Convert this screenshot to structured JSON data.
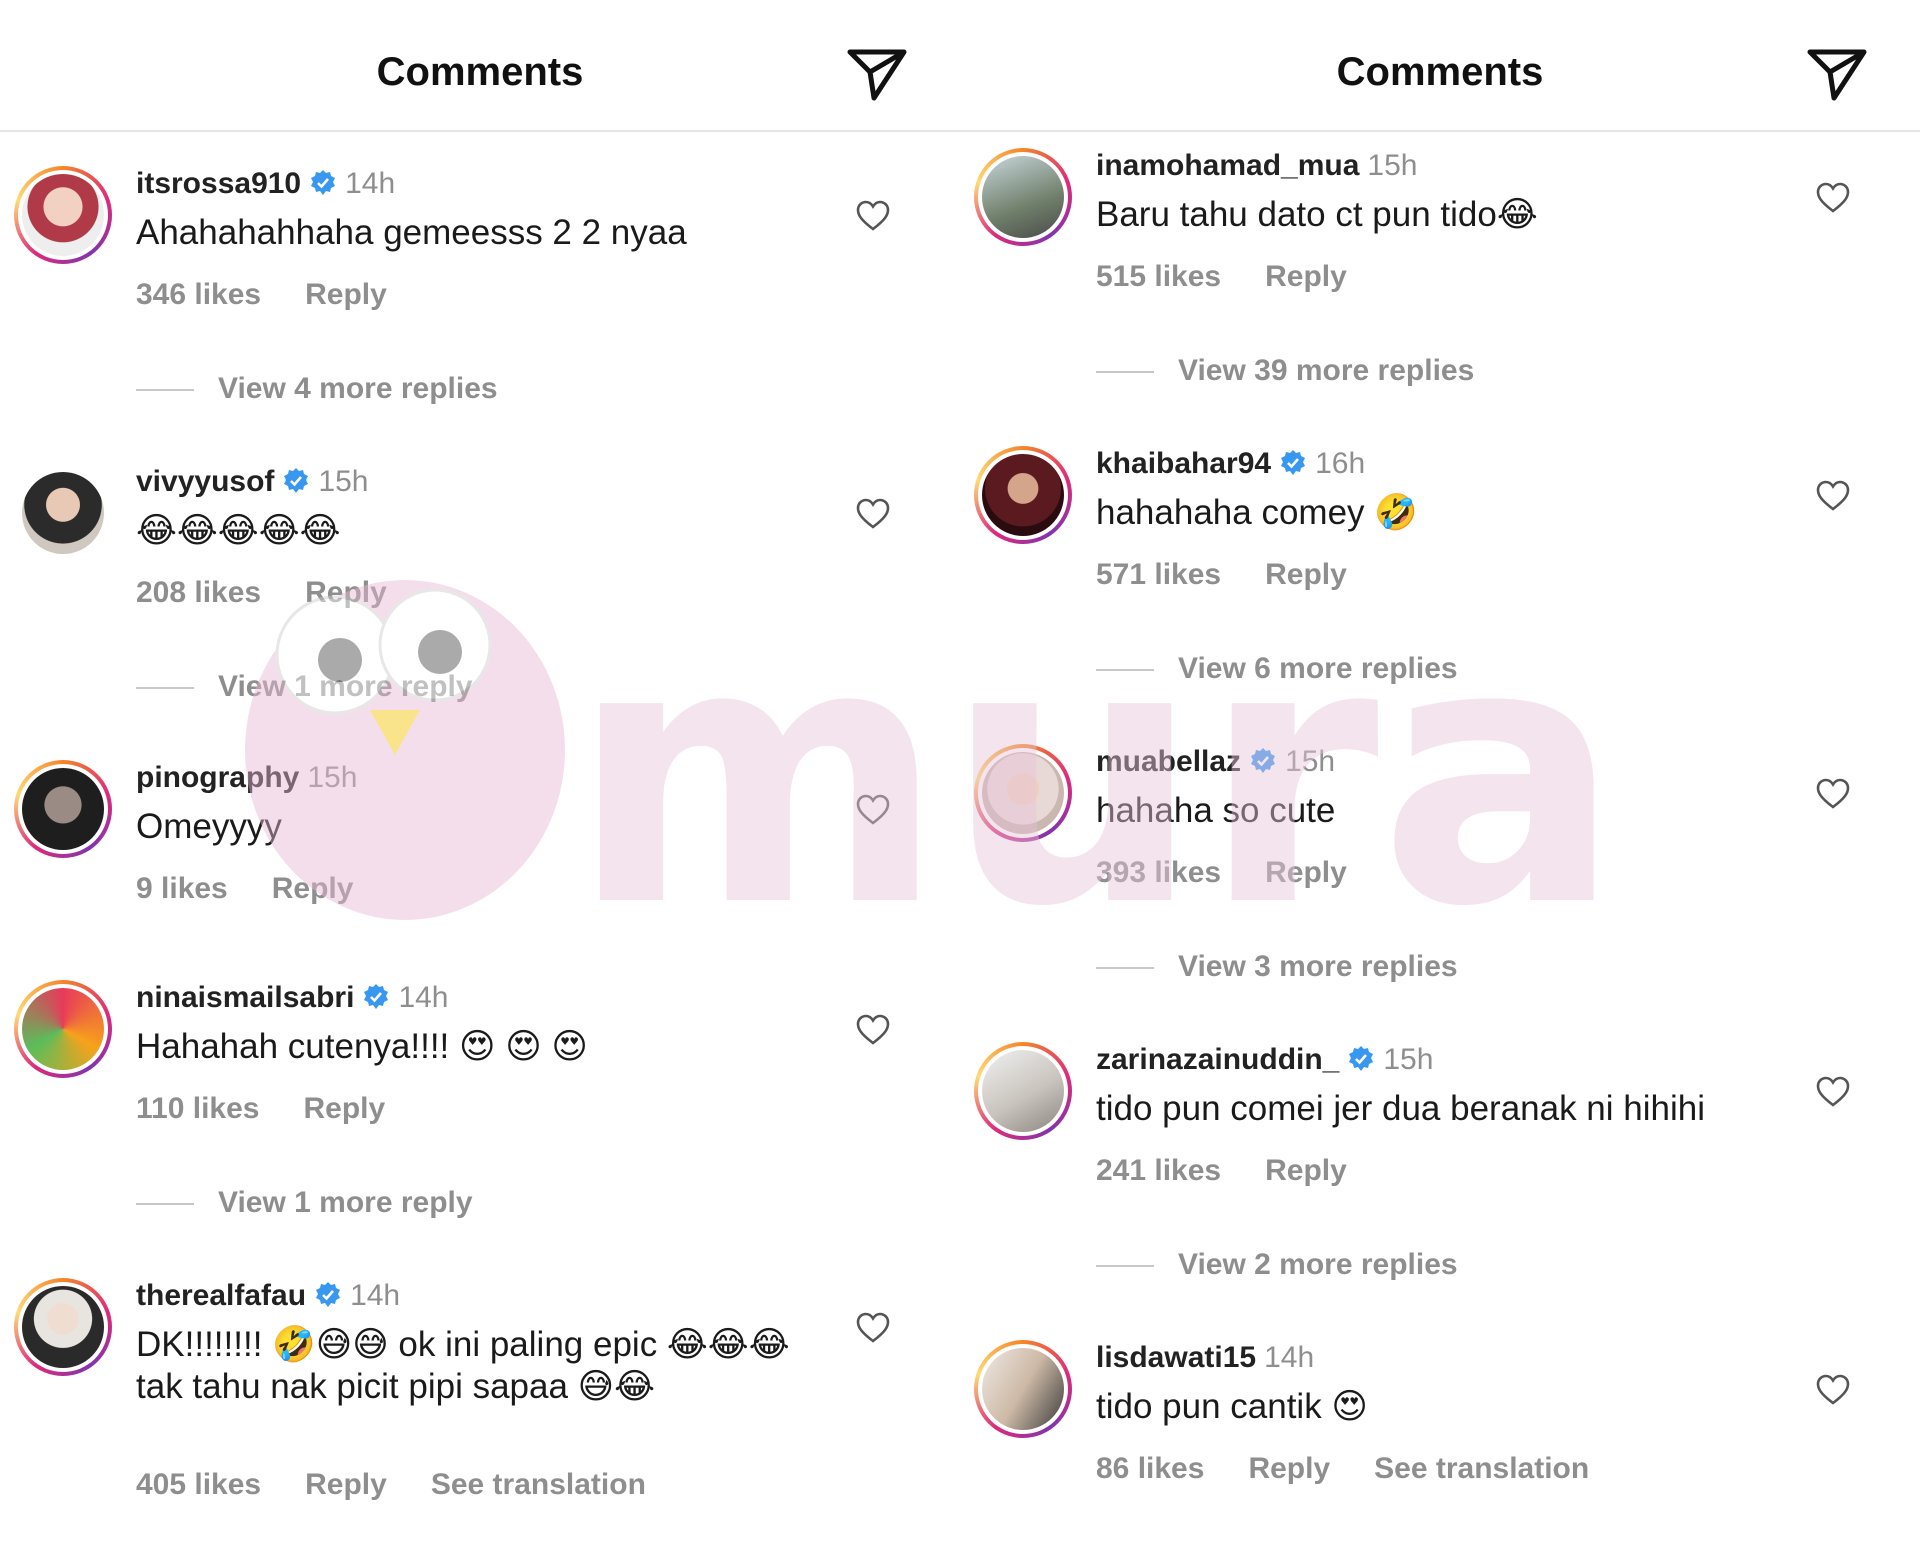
{
  "left": {
    "header": {
      "title": "Comments"
    },
    "comments": [
      {
        "username": "itsrossa910",
        "verified": true,
        "time": "14h",
        "text": "Ahahahahhaha gemeesss 2 2 nyaa",
        "likes": "346 likes",
        "reply": "Reply",
        "view_replies": "View 4 more replies"
      },
      {
        "username": "vivyyusof",
        "verified": true,
        "time": "15h",
        "text": "😂😂😂😂😂",
        "likes": "208 likes",
        "reply": "Reply",
        "view_replies": "View 1 more reply"
      },
      {
        "username": "pinography",
        "verified": false,
        "time": "15h",
        "text": "Omeyyyy",
        "likes": "9 likes",
        "reply": "Reply"
      },
      {
        "username": "ninaismailsabri",
        "verified": true,
        "time": "14h",
        "text": "Hahahah cutenya!!!! 😍 😍 😍",
        "likes": "110 likes",
        "reply": "Reply",
        "view_replies": "View 1 more reply"
      },
      {
        "username": "therealfafau",
        "verified": true,
        "time": "14h",
        "text": "DK!!!!!!!! 🤣😅😅 ok ini paling epic 😂😂😂 tak tahu nak picit pipi sapaa 😅😂",
        "likes": "405 likes",
        "reply": "Reply",
        "translation": "See translation"
      }
    ]
  },
  "right": {
    "header": {
      "title": "Comments"
    },
    "comments": [
      {
        "username": "inamohamad_mua",
        "verified": false,
        "time": "15h",
        "text": "Baru tahu dato ct pun tido😂",
        "likes": "515 likes",
        "reply": "Reply",
        "view_replies": "View 39 more replies"
      },
      {
        "username": "khaibahar94",
        "verified": true,
        "time": "16h",
        "text": "hahahaha comey 🤣",
        "likes": "571 likes",
        "reply": "Reply",
        "view_replies": "View 6 more replies"
      },
      {
        "username": "muabellaz",
        "verified": true,
        "time": "15h",
        "text": "hahaha so cute",
        "likes": "393 likes",
        "reply": "Reply",
        "view_replies": "View 3 more replies"
      },
      {
        "username": "zarinazainuddin_",
        "verified": true,
        "time": "15h",
        "text": "tido pun comei jer dua beranak ni hihihi",
        "likes": "241 likes",
        "reply": "Reply",
        "view_replies": "View 2 more replies"
      },
      {
        "username": "lisdawati15",
        "verified": false,
        "time": "14h",
        "text": "tido pun cantik 😍",
        "likes": "86 likes",
        "reply": "Reply",
        "translation": "See translation"
      }
    ]
  },
  "watermark": {
    "text": "murai"
  },
  "colors": {
    "verified": "#3897f0",
    "muted": "#8e8e8e",
    "watermark": "#e7c4d9"
  },
  "icons": [
    "send-icon",
    "heart-icon",
    "verified-badge-icon"
  ]
}
